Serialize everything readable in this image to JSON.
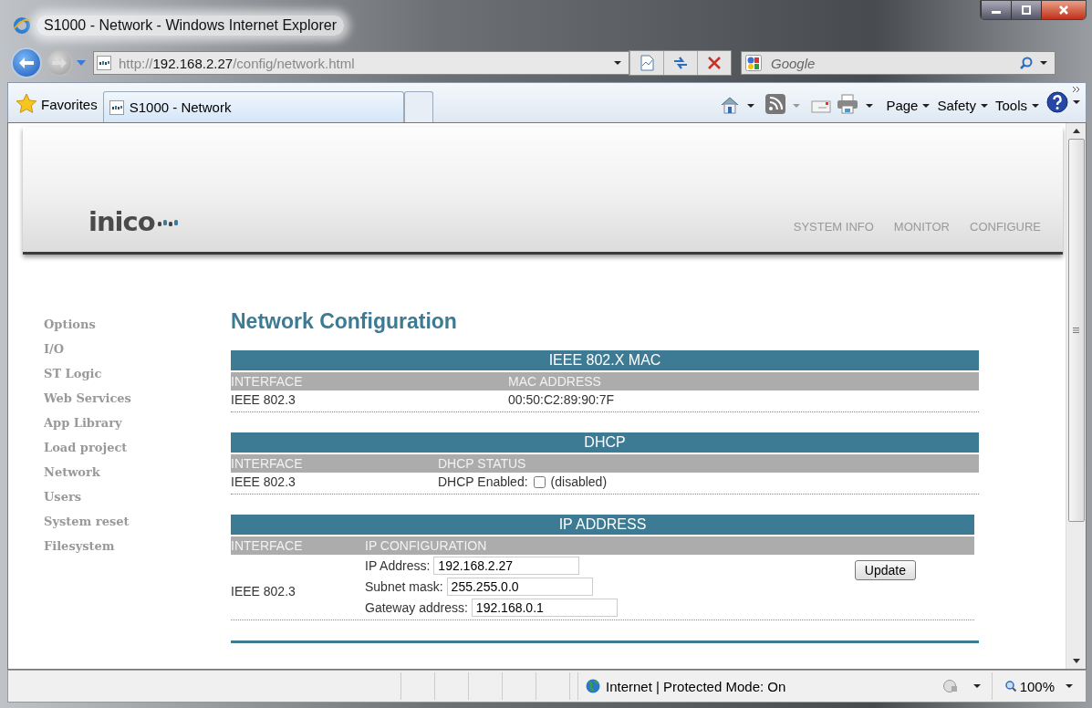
{
  "window": {
    "title": "S1000 - Network - Windows Internet Explorer"
  },
  "address_bar": {
    "url": "http://**192.168.2.27**/config/network.html"
  },
  "search": {
    "placeholder": "Google"
  },
  "favorites": "Favorites",
  "tabs": [
    {
      "label": "S1000 - Network",
      "selected": true
    }
  ],
  "command_bar": [
    "Page",
    "Safety",
    "Tools"
  ],
  "page": {
    "logo": "inico",
    "top_nav": [
      "SYSTEM INFO",
      "MONITOR",
      "CONFIGURE"
    ],
    "sidebar": {
      "items": [
        "Options",
        "I/O",
        "ST Logic",
        "Web Services",
        "App Library",
        "Load project",
        "Network",
        "Users",
        "System reset",
        "Filesystem"
      ]
    },
    "heading": "Network Configuration",
    "sections": [
      {
        "kind": "mac",
        "title": "IEEE 802.X MAC",
        "columns": [
          "INTERFACE",
          "MAC ADDRESS"
        ],
        "rows": [
          {
            "interface": "IEEE 802.3",
            "value": "00:50:C2:89:90:7F"
          }
        ]
      },
      {
        "kind": "dhcp",
        "title": "DHCP",
        "columns": [
          "INTERFACE",
          "DHCP STATUS"
        ],
        "rows": [
          {
            "interface": "IEEE 802.3",
            "label": "DHCP Enabled:",
            "checked": false,
            "note": "(disabled)"
          }
        ]
      },
      {
        "kind": "ip",
        "title": "IP ADDRESS",
        "columns": [
          "INTERFACE",
          "IP CONFIGURATION"
        ],
        "rows": [
          {
            "interface": "IEEE 802.3",
            "fields": [
              {
                "label": "IP Address:",
                "value": "192.168.2.27"
              },
              {
                "label": "Subnet mask:",
                "value": "255.255.0.0"
              },
              {
                "label": "Gateway address:",
                "value": "192.168.0.1"
              }
            ],
            "button": "Update"
          }
        ]
      }
    ]
  },
  "status_bar": {
    "zone": "Internet | Protected Mode: On",
    "zoom": "100%"
  }
}
